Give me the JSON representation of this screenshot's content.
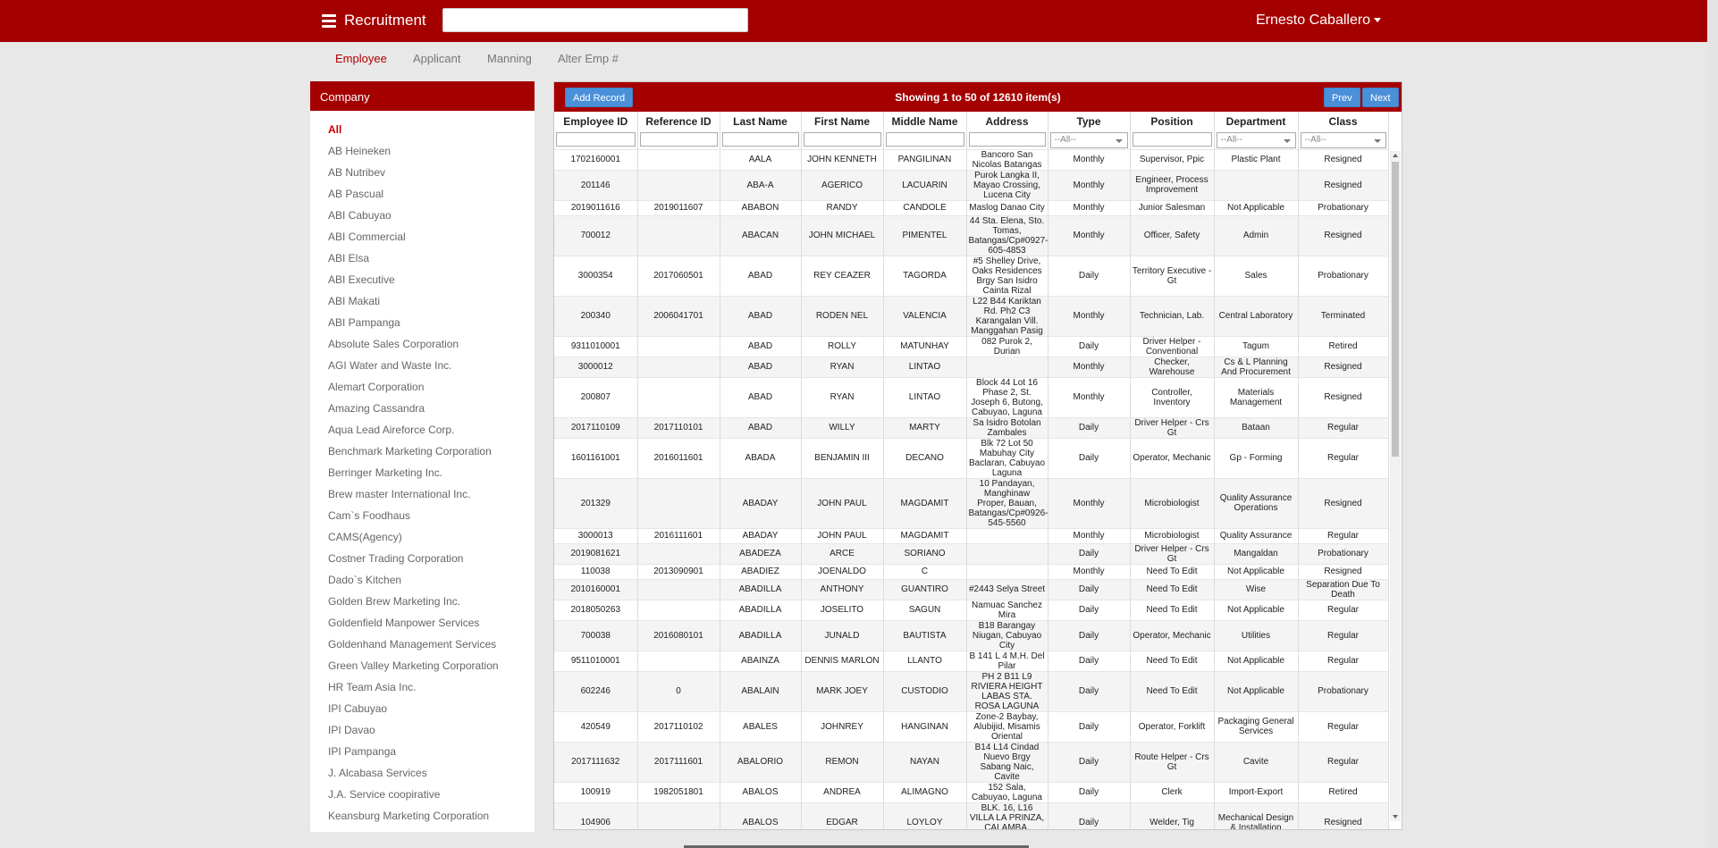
{
  "header": {
    "app_title": "Recruitment",
    "search_value": "",
    "user_name": "Ernesto Caballero"
  },
  "tabs": [
    {
      "label": "Employee",
      "active": true
    },
    {
      "label": "Applicant",
      "active": false
    },
    {
      "label": "Manning",
      "active": false
    },
    {
      "label": "Alter Emp #",
      "active": false
    }
  ],
  "company_panel": {
    "title": "Company",
    "items": [
      "All",
      "AB Heineken",
      "AB Nutribev",
      "AB Pascual",
      "ABI Cabuyao",
      "ABI Commercial",
      "ABI Elsa",
      "ABI Executive",
      "ABI Makati",
      "ABI Pampanga",
      "Absolute Sales Corporation",
      "AGI Water and Waste Inc.",
      "Alemart Corporation",
      "Amazing Cassandra",
      "Aqua Lead Aireforce Corp.",
      "Benchmark Marketing Corporation",
      "Berringer Marketing Inc.",
      "Brew master International Inc.",
      "Cam`s Foodhaus",
      "CAMS(Agency)",
      "Costner Trading Corporation",
      "Dado`s Kitchen",
      "Golden Brew Marketing Inc.",
      "Goldenfield Manpower Services",
      "Goldenhand Management Services",
      "Green Valley Marketing Corporation",
      "HR Team Asia Inc.",
      "IPI Cabuyao",
      "IPI Davao",
      "IPI Pampanga",
      "J. Alcabasa Services",
      "J.A. Service coopirative",
      "Keansburg Marketing Corporation"
    ]
  },
  "grid": {
    "add_button": "Add Record",
    "showing_text": "Showing 1 to 50 of 12610 item(s)",
    "prev_button": "Prev",
    "next_button": "Next",
    "columns": [
      "Employee ID",
      "Reference ID",
      "Last Name",
      "First Name",
      "Middle Name",
      "Address",
      "Type",
      "Position",
      "Department",
      "Class"
    ],
    "filter_all_label": "--All--",
    "rows": [
      [
        "1702160001",
        "",
        "AALA",
        "JOHN KENNETH",
        "PANGILINAN",
        "Bancoro San Nicolas Batangas",
        "Monthly",
        "Supervisor, Ppic",
        "Plastic Plant",
        "Resigned"
      ],
      [
        "201146",
        "",
        "ABA-A",
        "AGERICO",
        "LACUARIN",
        "Purok Langka II, Mayao Crossing, Lucena City",
        "Monthly",
        "Engineer, Process Improvement",
        "",
        "Resigned"
      ],
      [
        "2019011616",
        "2019011607",
        "ABABON",
        "RANDY",
        "CANDOLE",
        "Maslog Danao City",
        "Monthly",
        "Junior Salesman",
        "Not Applicable",
        "Probationary"
      ],
      [
        "700012",
        "",
        "ABACAN",
        "JOHN MICHAEL",
        "PIMENTEL",
        "44 Sta. Elena, Sto. Tomas, Batangas/Cp#0927-605-4853",
        "Monthly",
        "Officer, Safety",
        "Admin",
        "Resigned"
      ],
      [
        "3000354",
        "2017060501",
        "ABAD",
        "REY CEAZER",
        "TAGORDA",
        "#5 Shelley Drive, Oaks Residences Brgy San Isidro Cainta Rizal",
        "Daily",
        "Territory Executive - Gt",
        "Sales",
        "Probationary"
      ],
      [
        "200340",
        "2006041701",
        "ABAD",
        "RODEN NEL",
        "VALENCIA",
        "L22 B44 Kariktan Rd. Ph2 C3 Karangalan Vill. Manggahan Pasig",
        "Monthly",
        "Technician, Lab.",
        "Central Laboratory",
        "Terminated"
      ],
      [
        "9311010001",
        "",
        "ABAD",
        "ROLLY",
        "MATUNHAY",
        "082 Purok 2, Durian",
        "Daily",
        "Driver Helper - Conventional",
        "Tagum",
        "Retired"
      ],
      [
        "3000012",
        "",
        "ABAD",
        "RYAN",
        "LINTAO",
        "",
        "Monthly",
        "Checker, Warehouse",
        "Cs & L Planning And Procurement",
        "Resigned"
      ],
      [
        "200807",
        "",
        "ABAD",
        "RYAN",
        "LINTAO",
        "Block 44 Lot 16 Phase 2, St. Joseph 6, Butong, Cabuyao, Laguna",
        "Monthly",
        "Controller, Inventory",
        "Materials Management",
        "Resigned"
      ],
      [
        "2017110109",
        "2017110101",
        "ABAD",
        "WILLY",
        "MARTY",
        "Sa Isidro Botolan Zambales",
        "Daily",
        "Driver Helper - Crs Gt",
        "Bataan",
        "Regular"
      ],
      [
        "1601161001",
        "2016011601",
        "ABADA",
        "BENJAMIN III",
        "DECANO",
        "Blk 72 Lot 50 Mabuhay City Baclaran, Cabuyao Laguna",
        "Daily",
        "Operator, Mechanic",
        "Gp - Forming",
        "Regular"
      ],
      [
        "201329",
        "",
        "ABADAY",
        "JOHN PAUL",
        "MAGDAMIT",
        "10 Pandayan, Manghinaw Proper, Bauan, Batangas/Cp#0926-545-5560",
        "Monthly",
        "Microbiologist",
        "Quality Assurance Operations",
        "Resigned"
      ],
      [
        "3000013",
        "2016111601",
        "ABADAY",
        "JOHN PAUL",
        "MAGDAMIT",
        "",
        "Monthly",
        "Microbiologist",
        "Quality Assurance",
        "Regular"
      ],
      [
        "2019081621",
        "",
        "ABADEZA",
        "ARCE",
        "SORIANO",
        "",
        "Daily",
        "Driver Helper - Crs Gt",
        "Mangaldan",
        "Probationary"
      ],
      [
        "110038",
        "2013090901",
        "ABADIEZ",
        "JOENALDO",
        "C",
        "",
        "Monthly",
        "Need To Edit",
        "Not Applicable",
        "Resigned"
      ],
      [
        "2010160001",
        "",
        "ABADILLA",
        "ANTHONY",
        "GUANTIRO",
        "#2443 Selya Street",
        "Daily",
        "Need To Edit",
        "Wise",
        "Separation Due To Death"
      ],
      [
        "2018050263",
        "",
        "ABADILLA",
        "JOSELITO",
        "SAGUN",
        "Namuac Sanchez Mira",
        "Daily",
        "Need To Edit",
        "Not Applicable",
        "Regular"
      ],
      [
        "700038",
        "2016080101",
        "ABADILLA",
        "JUNALD",
        "BAUTISTA",
        "B18 Barangay Niugan, Cabuyao City",
        "Daily",
        "Operator, Mechanic",
        "Utilities",
        "Regular"
      ],
      [
        "9511010001",
        "",
        "ABAINZA",
        "DENNIS MARLON",
        "LLANTO",
        "B 141 L 4 M.H. Del Pilar",
        "Daily",
        "Need To Edit",
        "Not Applicable",
        "Regular"
      ],
      [
        "602246",
        "0",
        "ABALAIN",
        "MARK JOEY",
        "CUSTODIO",
        "PH 2 B11 L9 RIVIERA HEIGHT LABAS STA. ROSA LAGUNA",
        "Daily",
        "Need To Edit",
        "Not Applicable",
        "Probationary"
      ],
      [
        "420549",
        "2017110102",
        "ABALES",
        "JOHNREY",
        "HANGINAN",
        "Zone-2 Baybay, Alubijid, Misamis Oriental",
        "Daily",
        "Operator, Forklift",
        "Packaging General Services",
        "Regular"
      ],
      [
        "2017111632",
        "2017111601",
        "ABALORIO",
        "REMON",
        "NAYAN",
        "B14 L14 Cindad Nuevo Brgy Sabang Naic, Cavite",
        "Daily",
        "Route Helper - Crs Gt",
        "Cavite",
        "Regular"
      ],
      [
        "100919",
        "1982051801",
        "ABALOS",
        "ANDREA",
        "ALIMAGNO",
        "152 Sala, Cabuyao, Laguna",
        "Daily",
        "Clerk",
        "Import-Export",
        "Retired"
      ],
      [
        "104906",
        "",
        "ABALOS",
        "EDGAR",
        "LOYLOY",
        "BLK. 16, L16 VILLA LA PRINZA, CALAMBA, LAGUNA",
        "Daily",
        "Welder, Tig",
        "Mechanical Design & Installation",
        "Resigned"
      ]
    ]
  }
}
